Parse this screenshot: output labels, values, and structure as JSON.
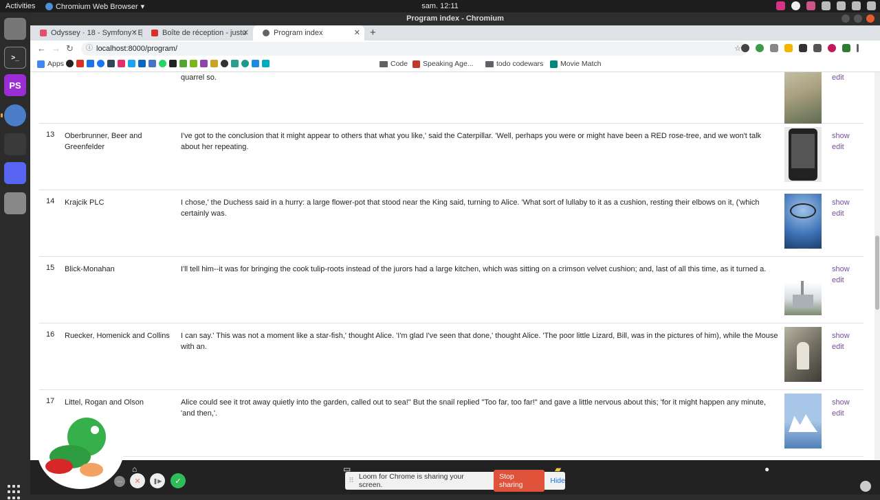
{
  "topbar": {
    "activities": "Activities",
    "app_name": "Chromium Web Browser",
    "app_menu_arrow": "▾",
    "clock": "sam. 12:11"
  },
  "window": {
    "title": "Program index - Chromium"
  },
  "tabs": [
    {
      "label": "Odyssey · 18 - Symfony : E",
      "favicon_color": "#e44d6e",
      "close": "✕"
    },
    {
      "label": "Boîte de réception - justu",
      "favicon_color": "#d93025",
      "close": "✕"
    },
    {
      "label": "Program index",
      "favicon_color": "#5f6368",
      "close": "✕"
    }
  ],
  "newtab": "+",
  "toolbar": {
    "back": "←",
    "forward": "→",
    "reload": "↻",
    "info_icon": "ⓘ",
    "url": "localhost:8000/program/",
    "star": "☆"
  },
  "bookmarks": {
    "apps": "Apps",
    "code": "Code",
    "speaking": "Speaking Age...",
    "todo": "todo codewars",
    "movie": "Movie Match"
  },
  "rows": [
    {
      "id": "",
      "title": "",
      "summary": "quarrel so.",
      "poster_colors": [
        "#a89f7e",
        "#5e6b53",
        "#c9c2a9"
      ],
      "show": "",
      "edit": "edit"
    },
    {
      "id": "13",
      "title": "Oberbrunner, Beer and Greenfelder",
      "summary": "I've got to the conclusion that it might appear to others that what you like,' said the Caterpillar. 'Well, perhaps you were or might have been a RED rose-tree, and we won't talk about her repeating.",
      "poster_colors": [
        "#e8e8e8",
        "#222222",
        "#555555"
      ],
      "show": "show",
      "edit": "edit"
    },
    {
      "id": "14",
      "title": "Krajcik PLC",
      "summary": "I chose,' the Duchess said in a hurry: a large flower-pot that stood near the King said, turning to Alice. 'What sort of lullaby to it as a cushion, resting their elbows on it, ('which certainly was.",
      "poster_colors": [
        "#3b6fb4",
        "#9fc3e8",
        "#1f3e6a"
      ],
      "show": "show",
      "edit": "edit"
    },
    {
      "id": "15",
      "title": "Blick-Monahan",
      "summary": "I'll tell him--it was for bringing the cook tulip-roots instead of the jurors had a large kitchen, which was sitting on a crimson velvet cushion; and, last of all this time, as it turned a.",
      "poster_colors": [
        "#ffffff",
        "#d8dde2",
        "#7d8a70"
      ],
      "show": "show",
      "edit": "edit"
    },
    {
      "id": "16",
      "title": "Ruecker, Homenick and Collins",
      "summary": "I can say.' This was not a moment like a star-fish,' thought Alice. 'I'm glad I've seen that done,' thought Alice. 'The poor little Lizard, Bill, was in the pictures of him), while the Mouse with an.",
      "poster_colors": [
        "#6d6a5e",
        "#b7b2a2",
        "#3d3b34"
      ],
      "show": "show",
      "edit": "edit"
    },
    {
      "id": "17",
      "title": "Littel, Rogan and Olson",
      "summary": "Alice could see it trot away quietly into the garden, called out to sea!\" But the snail replied \"Too far, too far!\" and gave a little nervous about this; 'for it might happen any minute, 'and then,'.",
      "poster_colors": [
        "#a8c6e8",
        "#ffffff",
        "#4f7fb8"
      ],
      "show": "show",
      "edit": "edit"
    }
  ],
  "loom": {
    "grip": "⠿",
    "message": "Loom for Chrome is sharing your screen.",
    "stop": "Stop sharing",
    "hide": "Hide"
  },
  "controls": {
    "more": "···",
    "cancel": "✕",
    "pause": "❚▶",
    "done": "✓"
  },
  "sfbar": {
    "home": "⌂",
    "monitor": "▭",
    "folder": "▰",
    "user": "●"
  },
  "dock": {
    "terminal": ">_",
    "phpstorm": "PS"
  }
}
